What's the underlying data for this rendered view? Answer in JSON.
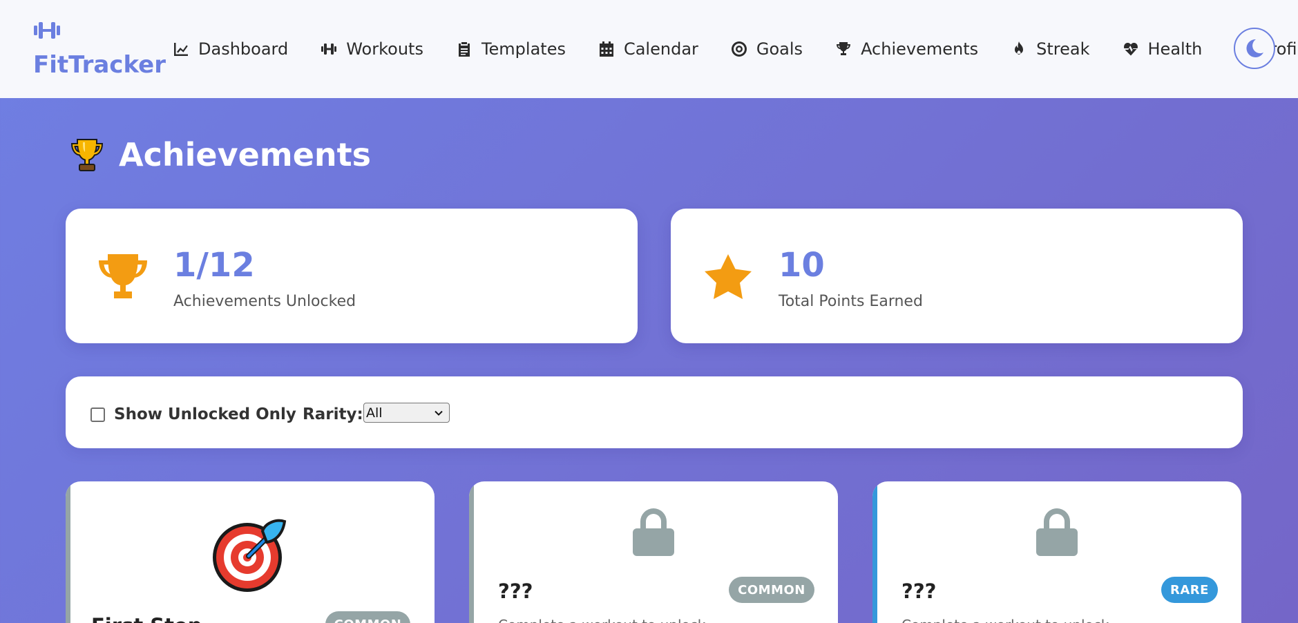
{
  "brand": {
    "name": "FitTracker",
    "icon": "dumbbell-icon"
  },
  "nav": [
    {
      "label": "Dashboard",
      "icon": "chart-line-icon"
    },
    {
      "label": "Workouts",
      "icon": "dumbbell-icon"
    },
    {
      "label": "Templates",
      "icon": "clipboard-icon"
    },
    {
      "label": "Calendar",
      "icon": "calendar-icon"
    },
    {
      "label": "Goals",
      "icon": "target-icon"
    },
    {
      "label": "Achievements",
      "icon": "trophy-icon"
    },
    {
      "label": "Streak",
      "icon": "fire-icon"
    },
    {
      "label": "Health",
      "icon": "heartbeat-icon"
    },
    {
      "label": "Profile",
      "icon": "user-icon"
    }
  ],
  "theme_toggle": {
    "icon": "moon-icon"
  },
  "page": {
    "title": "Achievements",
    "title_icon": "trophy-icon"
  },
  "stats": {
    "unlocked": {
      "value": "1/12",
      "label": "Achievements Unlocked",
      "icon": "trophy-icon"
    },
    "points": {
      "value": "10",
      "label": "Total Points Earned",
      "icon": "star-icon"
    }
  },
  "filters": {
    "show_unlocked_label": "Show Unlocked Only",
    "show_unlocked_checked": false,
    "rarity_label": "Rarity:",
    "rarity_selected": "All"
  },
  "achievements": [
    {
      "name": "First Step",
      "rarity": "COMMON",
      "locked": false,
      "icon": "target-arrow-icon",
      "description": ""
    },
    {
      "name": "???",
      "rarity": "COMMON",
      "locked": true,
      "icon": "lock-icon",
      "description": "Complete a workout to unlock"
    },
    {
      "name": "???",
      "rarity": "RARE",
      "locked": true,
      "icon": "lock-icon",
      "description": "Complete a workout to unlock"
    }
  ],
  "colors": {
    "accent": "#6b7fe0",
    "common": "#95a5a6",
    "rare": "#3498db",
    "gold": "#f39c12",
    "nav_bg": "#f7f8fc"
  }
}
